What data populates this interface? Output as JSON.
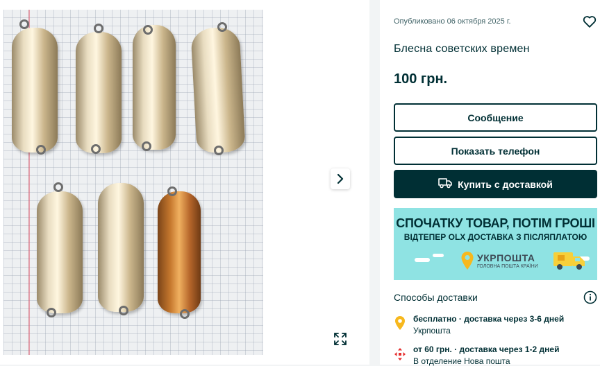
{
  "listing": {
    "published": "Опубликовано 06 октября 2025 г.",
    "title": "Блесна советских времен",
    "price": "100 грн."
  },
  "buttons": {
    "message": "Сообщение",
    "show_phone": "Показать телефон",
    "buy_delivery": "Купить с доставкой"
  },
  "banner": {
    "headline": "СПОЧАТКУ ТОВАР, ПОТІМ ГРОШІ",
    "subline": "ВІДТЕПЕР OLX ДОСТАВКА З ПІСЛЯПЛАТОЮ",
    "logo_name": "УКРПОШТА",
    "logo_sub": "ГОЛОВНА ПОШТА КРАЇНИ"
  },
  "delivery": {
    "section_title": "Способы доставки",
    "options": [
      {
        "main": "бесплатно · доставка через 3-6 дней",
        "sub": "Укрпошта",
        "icon": "ukrposhta-pin-icon"
      },
      {
        "main": "от 60 грн. · доставка через 1-2 дней",
        "sub": "В отделение Нова пошта",
        "icon": "nova-poshta-icon"
      }
    ]
  },
  "icons": {
    "gallery_next": "chevron-right-icon",
    "gallery_expand": "expand-icon",
    "favorite": "heart-icon",
    "info": "info-icon",
    "truck": "truck-icon"
  },
  "colors": {
    "brand_dark": "#002f34",
    "banner_bg": "#8fe3e3",
    "ukrposhta_yellow": "#f7b81e",
    "nova_poshta_red": "#e52d2d"
  }
}
